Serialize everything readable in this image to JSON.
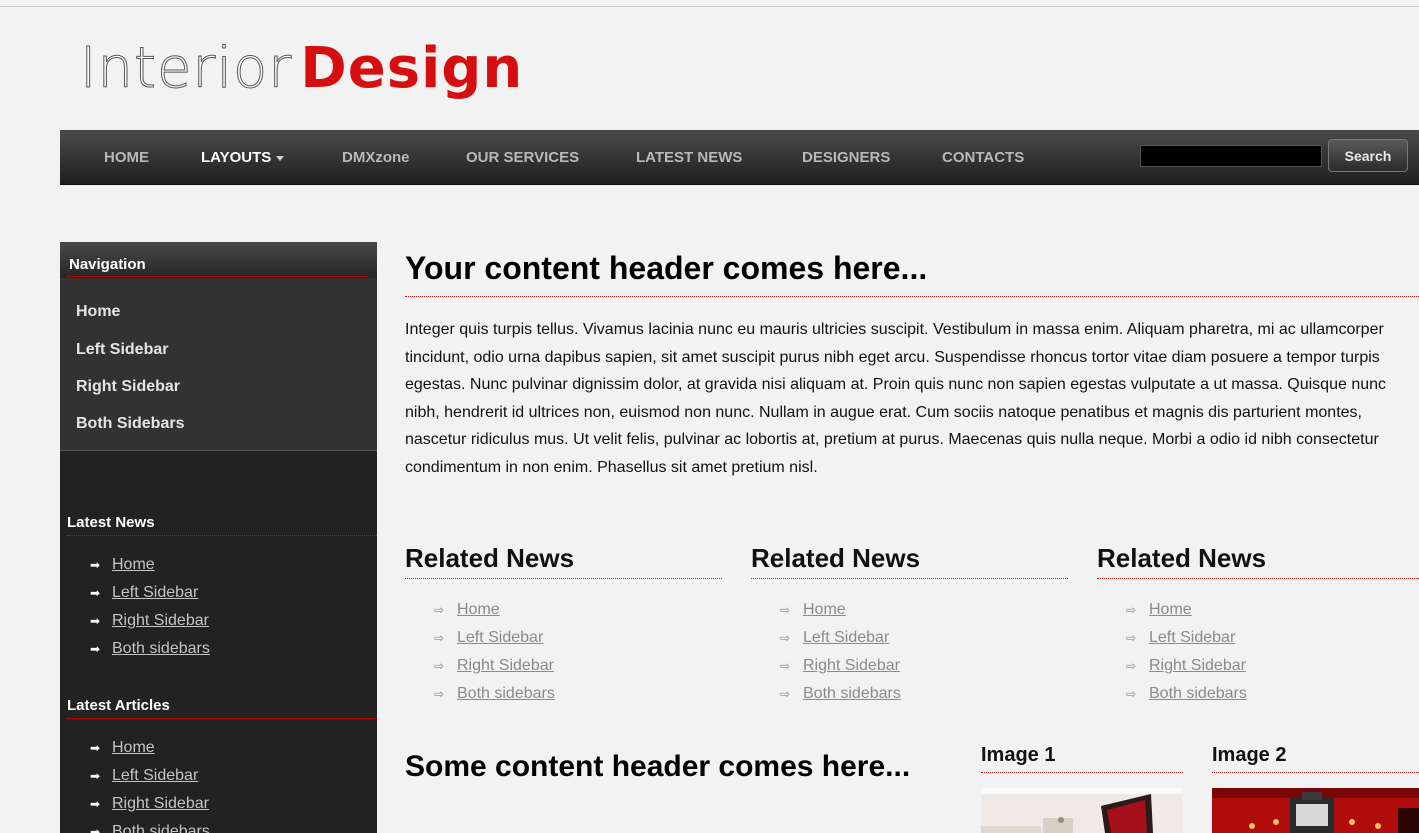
{
  "logo": {
    "light": "Interior",
    "bold": "Design"
  },
  "nav": {
    "items": [
      "HOME",
      "LAYOUTS",
      "DMXzone",
      "OUR SERVICES",
      "LATEST NEWS",
      "DESIGNERS",
      "CONTACTS"
    ],
    "active": "LAYOUTS",
    "search_button": "Search",
    "search_value": ""
  },
  "sidebar": {
    "navigation": {
      "title": "Navigation",
      "items": [
        "Home",
        "Left Sidebar",
        "Right Sidebar",
        "Both Sidebars"
      ]
    },
    "latest_news": {
      "title": "Latest News",
      "items": [
        "Home",
        "Left Sidebar",
        "Right Sidebar",
        "Both sidebars"
      ]
    },
    "latest_articles": {
      "title": "Latest Articles",
      "items": [
        "Home",
        "Left Sidebar",
        "Right Sidebar",
        "Both sidebars"
      ]
    }
  },
  "main": {
    "header": "Your content header comes here...",
    "paragraph": "Integer quis turpis tellus. Vivamus lacinia nunc eu mauris ultricies suscipit. Vestibulum in massa enim. Aliquam pharetra, mi ac ullamcorper tincidunt, odio urna dapibus sapien, sit amet suscipit purus nibh eget arcu. Suspendisse rhoncus tortor vitae diam posuere a tempor turpis egestas. Nunc pulvinar dignissim dolor, at gravida nisi aliquam at. Proin quis nunc non sapien egestas vulputate a ut massa. Quisque nunc nibh, hendrerit id ultrices non, euismod non nunc. Nullam in augue erat. Cum sociis natoque penatibus et magnis dis parturient montes, nascetur ridiculus mus. Ut velit felis, pulvinar ac lobortis at, pretium at purus. Maecenas quis nulla neque. Morbi a odio id nibh consectetur condimentum in non enim. Phasellus sit amet pretium nisl.",
    "related": [
      {
        "title": "Related News",
        "items": [
          "Home",
          "Left Sidebar",
          "Right Sidebar",
          "Both sidebars"
        ]
      },
      {
        "title": "Related News",
        "items": [
          "Home",
          "Left Sidebar",
          "Right Sidebar",
          "Both sidebars"
        ]
      },
      {
        "title": "Related News",
        "items": [
          "Home",
          "Left Sidebar",
          "Right Sidebar",
          "Both sidebars"
        ]
      }
    ],
    "subheader": "Some content header comes here...",
    "images": [
      {
        "title": "Image 1"
      },
      {
        "title": "Image 2"
      }
    ]
  },
  "colors": {
    "accent": "#d50f0f",
    "nav_bg": "#2a2a2a",
    "sidebar_bg": "#222222",
    "page_bg": "#f2f2f2"
  }
}
